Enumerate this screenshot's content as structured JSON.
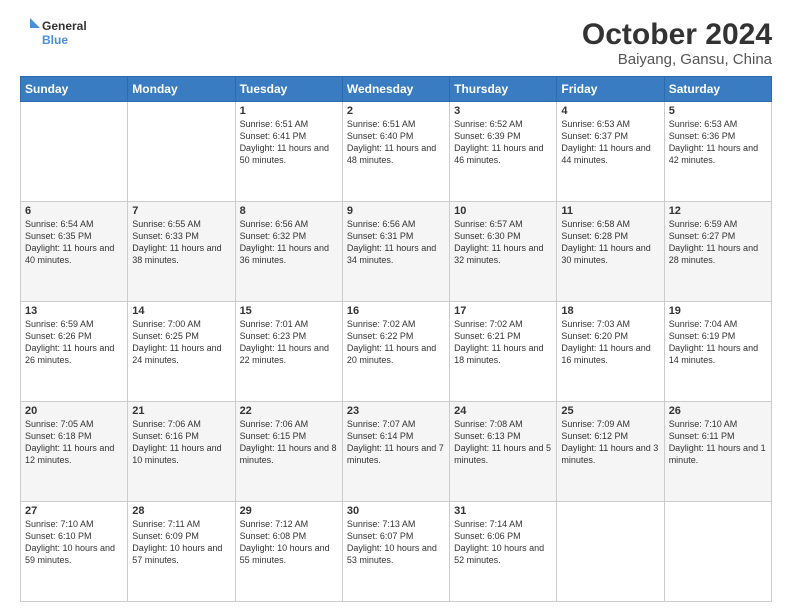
{
  "logo": {
    "line1": "General",
    "line2": "Blue"
  },
  "title": "October 2024",
  "subtitle": "Baiyang, Gansu, China",
  "days_of_week": [
    "Sunday",
    "Monday",
    "Tuesday",
    "Wednesday",
    "Thursday",
    "Friday",
    "Saturday"
  ],
  "weeks": [
    [
      {
        "day": null,
        "content": null
      },
      {
        "day": null,
        "content": null
      },
      {
        "day": "1",
        "content": "Sunrise: 6:51 AM\nSunset: 6:41 PM\nDaylight: 11 hours and 50 minutes."
      },
      {
        "day": "2",
        "content": "Sunrise: 6:51 AM\nSunset: 6:40 PM\nDaylight: 11 hours and 48 minutes."
      },
      {
        "day": "3",
        "content": "Sunrise: 6:52 AM\nSunset: 6:39 PM\nDaylight: 11 hours and 46 minutes."
      },
      {
        "day": "4",
        "content": "Sunrise: 6:53 AM\nSunset: 6:37 PM\nDaylight: 11 hours and 44 minutes."
      },
      {
        "day": "5",
        "content": "Sunrise: 6:53 AM\nSunset: 6:36 PM\nDaylight: 11 hours and 42 minutes."
      }
    ],
    [
      {
        "day": "6",
        "content": "Sunrise: 6:54 AM\nSunset: 6:35 PM\nDaylight: 11 hours and 40 minutes."
      },
      {
        "day": "7",
        "content": "Sunrise: 6:55 AM\nSunset: 6:33 PM\nDaylight: 11 hours and 38 minutes."
      },
      {
        "day": "8",
        "content": "Sunrise: 6:56 AM\nSunset: 6:32 PM\nDaylight: 11 hours and 36 minutes."
      },
      {
        "day": "9",
        "content": "Sunrise: 6:56 AM\nSunset: 6:31 PM\nDaylight: 11 hours and 34 minutes."
      },
      {
        "day": "10",
        "content": "Sunrise: 6:57 AM\nSunset: 6:30 PM\nDaylight: 11 hours and 32 minutes."
      },
      {
        "day": "11",
        "content": "Sunrise: 6:58 AM\nSunset: 6:28 PM\nDaylight: 11 hours and 30 minutes."
      },
      {
        "day": "12",
        "content": "Sunrise: 6:59 AM\nSunset: 6:27 PM\nDaylight: 11 hours and 28 minutes."
      }
    ],
    [
      {
        "day": "13",
        "content": "Sunrise: 6:59 AM\nSunset: 6:26 PM\nDaylight: 11 hours and 26 minutes."
      },
      {
        "day": "14",
        "content": "Sunrise: 7:00 AM\nSunset: 6:25 PM\nDaylight: 11 hours and 24 minutes."
      },
      {
        "day": "15",
        "content": "Sunrise: 7:01 AM\nSunset: 6:23 PM\nDaylight: 11 hours and 22 minutes."
      },
      {
        "day": "16",
        "content": "Sunrise: 7:02 AM\nSunset: 6:22 PM\nDaylight: 11 hours and 20 minutes."
      },
      {
        "day": "17",
        "content": "Sunrise: 7:02 AM\nSunset: 6:21 PM\nDaylight: 11 hours and 18 minutes."
      },
      {
        "day": "18",
        "content": "Sunrise: 7:03 AM\nSunset: 6:20 PM\nDaylight: 11 hours and 16 minutes."
      },
      {
        "day": "19",
        "content": "Sunrise: 7:04 AM\nSunset: 6:19 PM\nDaylight: 11 hours and 14 minutes."
      }
    ],
    [
      {
        "day": "20",
        "content": "Sunrise: 7:05 AM\nSunset: 6:18 PM\nDaylight: 11 hours and 12 minutes."
      },
      {
        "day": "21",
        "content": "Sunrise: 7:06 AM\nSunset: 6:16 PM\nDaylight: 11 hours and 10 minutes."
      },
      {
        "day": "22",
        "content": "Sunrise: 7:06 AM\nSunset: 6:15 PM\nDaylight: 11 hours and 8 minutes."
      },
      {
        "day": "23",
        "content": "Sunrise: 7:07 AM\nSunset: 6:14 PM\nDaylight: 11 hours and 7 minutes."
      },
      {
        "day": "24",
        "content": "Sunrise: 7:08 AM\nSunset: 6:13 PM\nDaylight: 11 hours and 5 minutes."
      },
      {
        "day": "25",
        "content": "Sunrise: 7:09 AM\nSunset: 6:12 PM\nDaylight: 11 hours and 3 minutes."
      },
      {
        "day": "26",
        "content": "Sunrise: 7:10 AM\nSunset: 6:11 PM\nDaylight: 11 hours and 1 minute."
      }
    ],
    [
      {
        "day": "27",
        "content": "Sunrise: 7:10 AM\nSunset: 6:10 PM\nDaylight: 10 hours and 59 minutes."
      },
      {
        "day": "28",
        "content": "Sunrise: 7:11 AM\nSunset: 6:09 PM\nDaylight: 10 hours and 57 minutes."
      },
      {
        "day": "29",
        "content": "Sunrise: 7:12 AM\nSunset: 6:08 PM\nDaylight: 10 hours and 55 minutes."
      },
      {
        "day": "30",
        "content": "Sunrise: 7:13 AM\nSunset: 6:07 PM\nDaylight: 10 hours and 53 minutes."
      },
      {
        "day": "31",
        "content": "Sunrise: 7:14 AM\nSunset: 6:06 PM\nDaylight: 10 hours and 52 minutes."
      },
      {
        "day": null,
        "content": null
      },
      {
        "day": null,
        "content": null
      }
    ]
  ]
}
